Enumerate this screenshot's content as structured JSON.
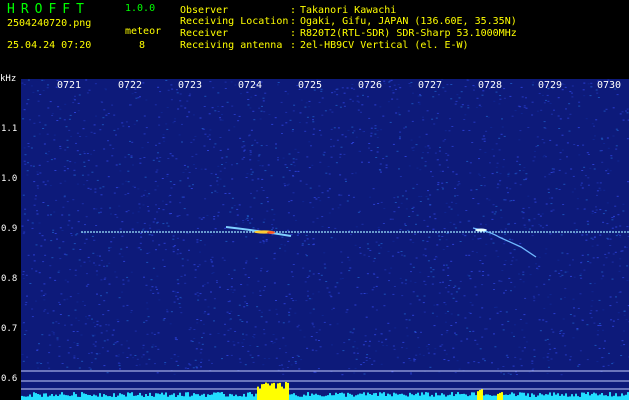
{
  "header": {
    "app_title": "HROFFT",
    "app_version": "1.0.0",
    "filename": "2504240720.png",
    "timestamp": "25.04.24 07:20",
    "meteor_label": "meteor",
    "meteor_count": "8",
    "info": [
      {
        "label": "Observer",
        "value": "Takanori Kawachi"
      },
      {
        "label": "Receiving Location",
        "value": "Ogaki, Gifu, JAPAN (136.60E, 35.35N)"
      },
      {
        "label": "Receiver",
        "value": "R820T2(RTL-SDR) SDR-Sharp 53.1000MHz"
      },
      {
        "label": "Receiving antenna",
        "value": "2el-HB9CV Vertical (el. E-W)"
      }
    ]
  },
  "spectrogram": {
    "y_unit": "kHz",
    "y_ticks": [
      "1.1",
      "1.0",
      "0.9",
      "0.8",
      "0.7",
      "0.6"
    ],
    "x_ticks": [
      "0721",
      "0722",
      "0723",
      "0724",
      "0725",
      "0726",
      "0727",
      "0728",
      "0729",
      "0730"
    ],
    "background_color": "#0d1a7a",
    "carrier_color": "#9fe6ff",
    "echo_color": "#ffff00"
  }
}
